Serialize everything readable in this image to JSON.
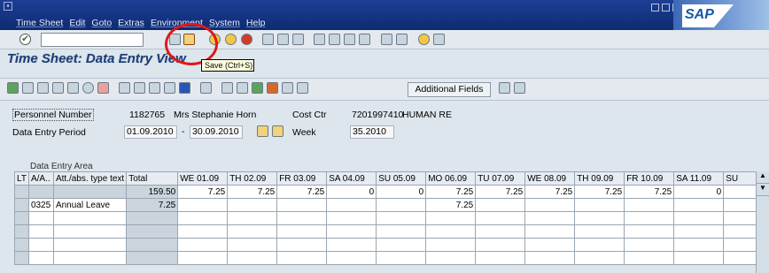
{
  "menubar": {
    "items": [
      "Time Sheet",
      "Edit",
      "Goto",
      "Extras",
      "Environment",
      "System",
      "Help"
    ],
    "logo": "SAP"
  },
  "toolbar1": {
    "tooltip": "Save  (Ctrl+S)"
  },
  "page": {
    "title": "Time Sheet: Data Entry View"
  },
  "toolbar2": {
    "additional_fields_label": "Additional Fields"
  },
  "header": {
    "personnel_number_label": "Personnel Number",
    "personnel_number": "1182765",
    "employee_name": "Mrs Stephanie Horn",
    "cost_ctr_label": "Cost Ctr",
    "cost_ctr_value": "7201997410",
    "cost_ctr_text": "HUMAN RE",
    "period_label": "Data Entry Period",
    "period_from": "01.09.2010",
    "period_sep": "-",
    "period_to": "30.09.2010",
    "week_label": "Week",
    "week_value": "35.2010"
  },
  "data_area": {
    "caption": "Data Entry Area",
    "columns": [
      "LT",
      "A/A..",
      "Att./abs. type text",
      "Total",
      "WE 01.09",
      "TH 02.09",
      "FR 03.09",
      "SA 04.09",
      "SU 05.09",
      "MO 06.09",
      "TU 07.09",
      "WE 08.09",
      "TH 09.09",
      "FR 10.09",
      "SA 11.09",
      "SU"
    ],
    "totals_row": [
      "",
      "",
      "",
      "159.50",
      "7.25",
      "7.25",
      "7.25",
      "0",
      "0",
      "7.25",
      "7.25",
      "7.25",
      "7.25",
      "7.25",
      "0",
      ""
    ],
    "rows": [
      [
        "",
        "0325",
        "Annual Leave",
        "7.25",
        "",
        "",
        "",
        "",
        "",
        "7.25",
        "",
        "",
        "",
        "",
        "",
        ""
      ]
    ]
  },
  "colors": {
    "menubar_bg": "#1c3f93",
    "screen_bg": "#dde6ed",
    "highlight_circle": "#e01818"
  }
}
